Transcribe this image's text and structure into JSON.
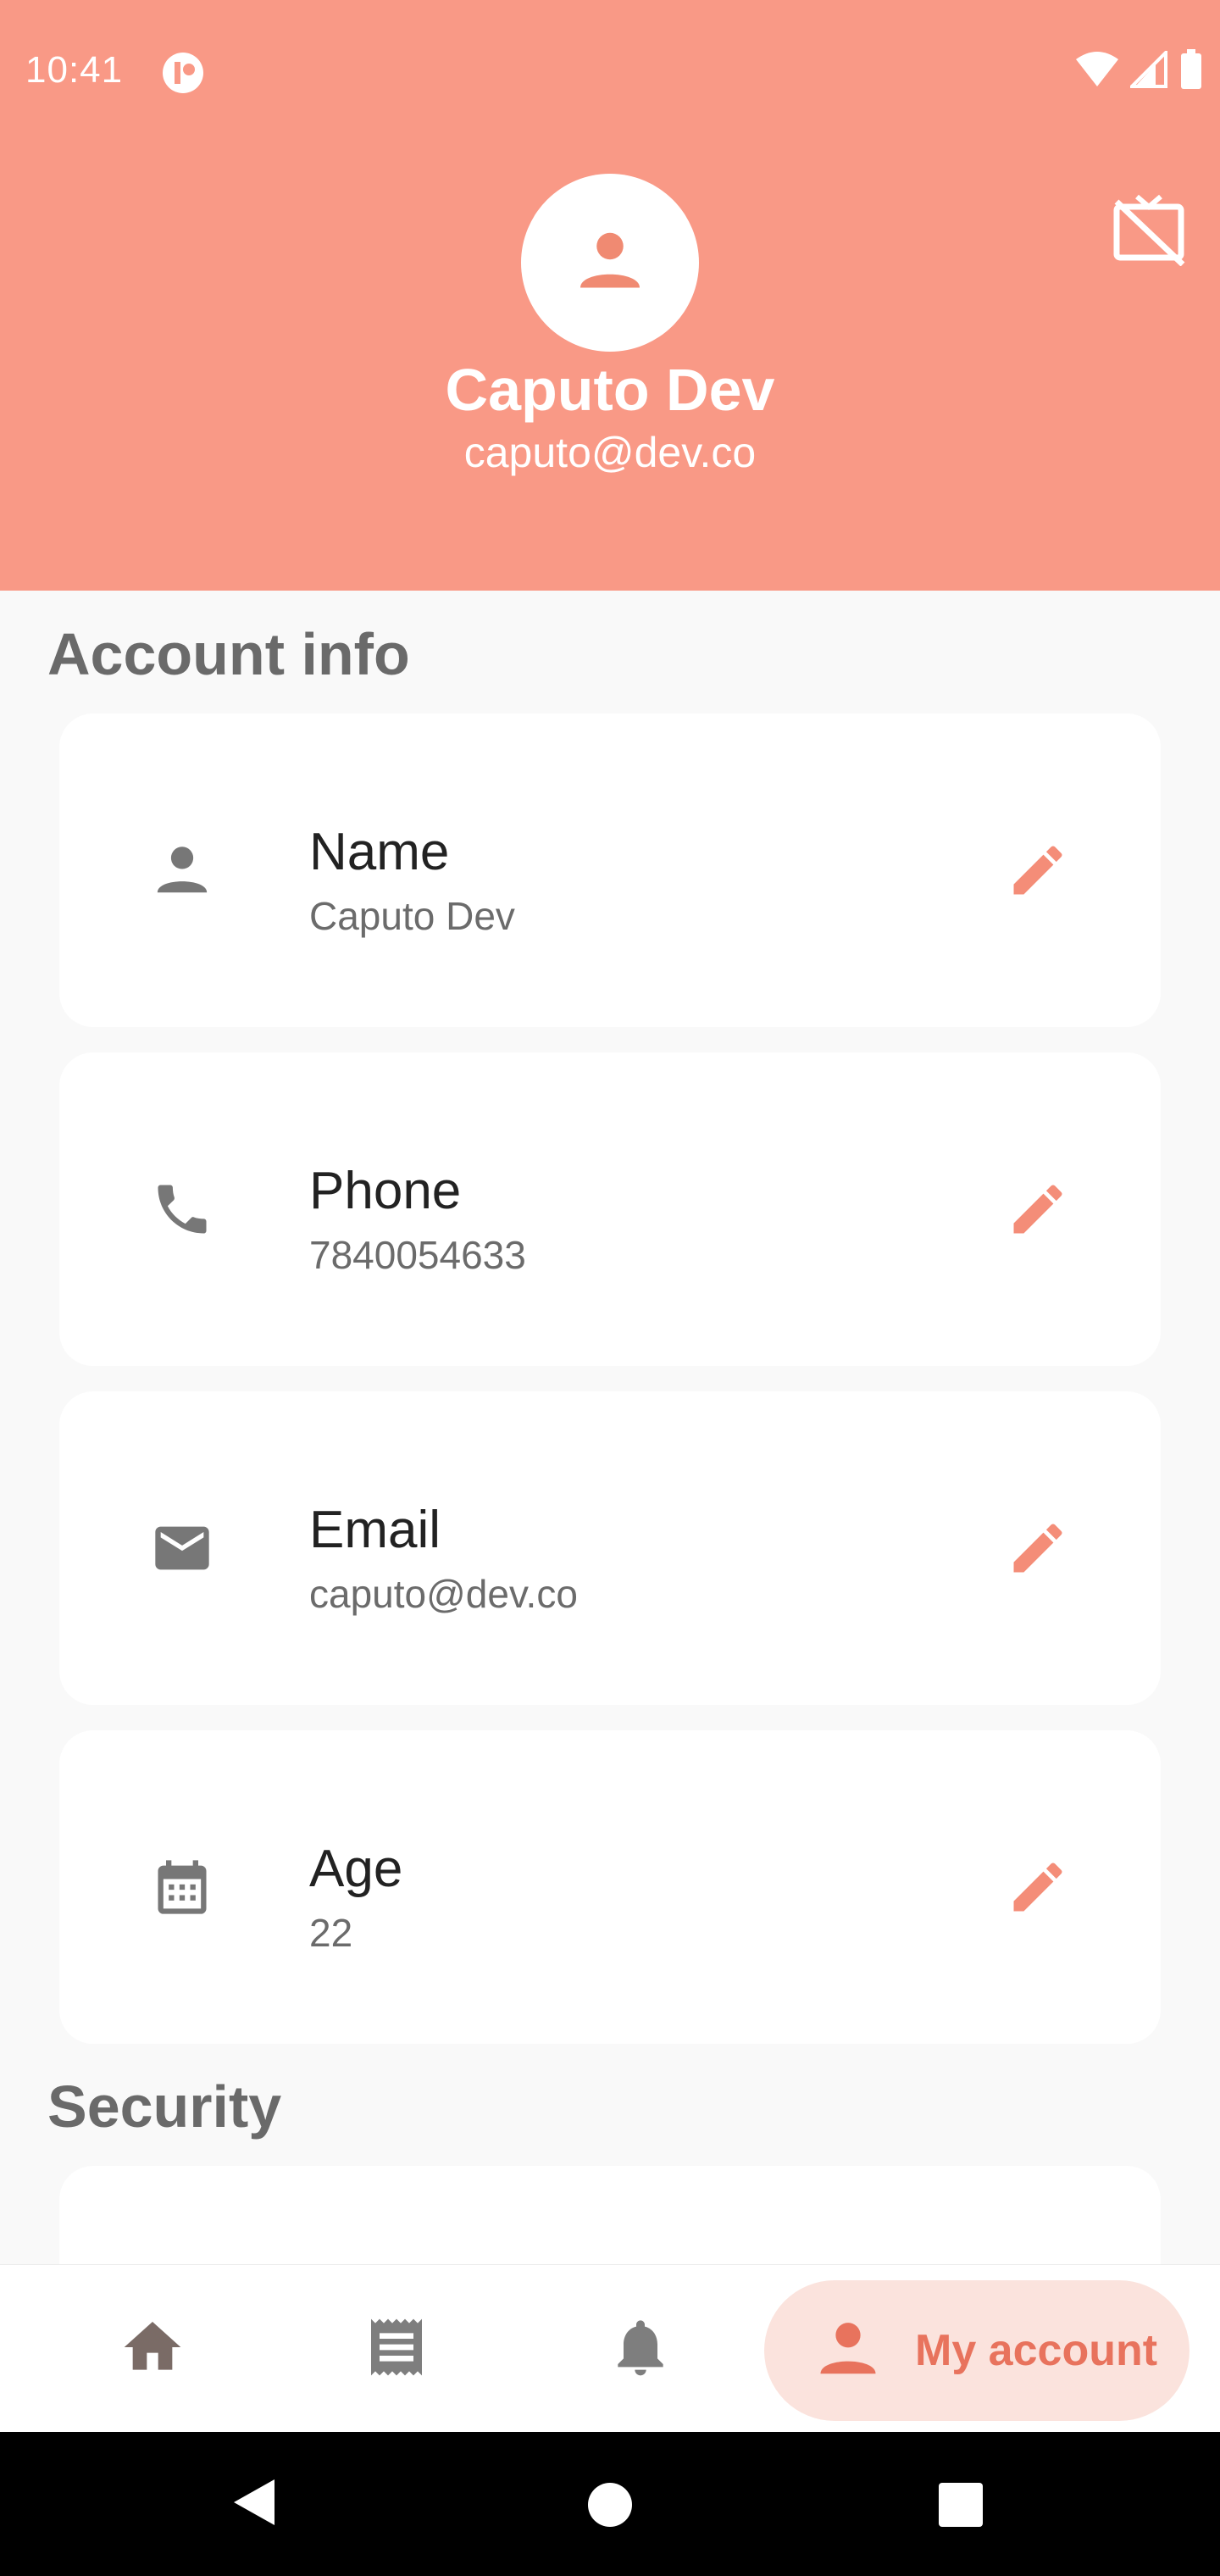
{
  "status_bar": {
    "time": "10:41"
  },
  "profile": {
    "name": "Caputo Dev",
    "email": "caputo@dev.co"
  },
  "sections": {
    "account_info": "Account info",
    "security": "Security"
  },
  "fields": [
    {
      "label": "Name",
      "value": "Caputo Dev",
      "icon": "person-icon"
    },
    {
      "label": "Phone",
      "value": "7840054633",
      "icon": "phone-icon"
    },
    {
      "label": "Email",
      "value": "caputo@dev.co",
      "icon": "mail-icon"
    },
    {
      "label": "Age",
      "value": "22",
      "icon": "calendar-icon"
    }
  ],
  "bottom_nav": {
    "items": [
      {
        "icon": "home-icon"
      },
      {
        "icon": "receipt-icon"
      },
      {
        "icon": "bell-icon"
      },
      {
        "icon": "person-icon",
        "label": "My account",
        "active": true
      }
    ]
  },
  "colors": {
    "accent": "#f99986",
    "accent_dark": "#e8735d",
    "nav_active_bg": "#fbe3dd"
  }
}
